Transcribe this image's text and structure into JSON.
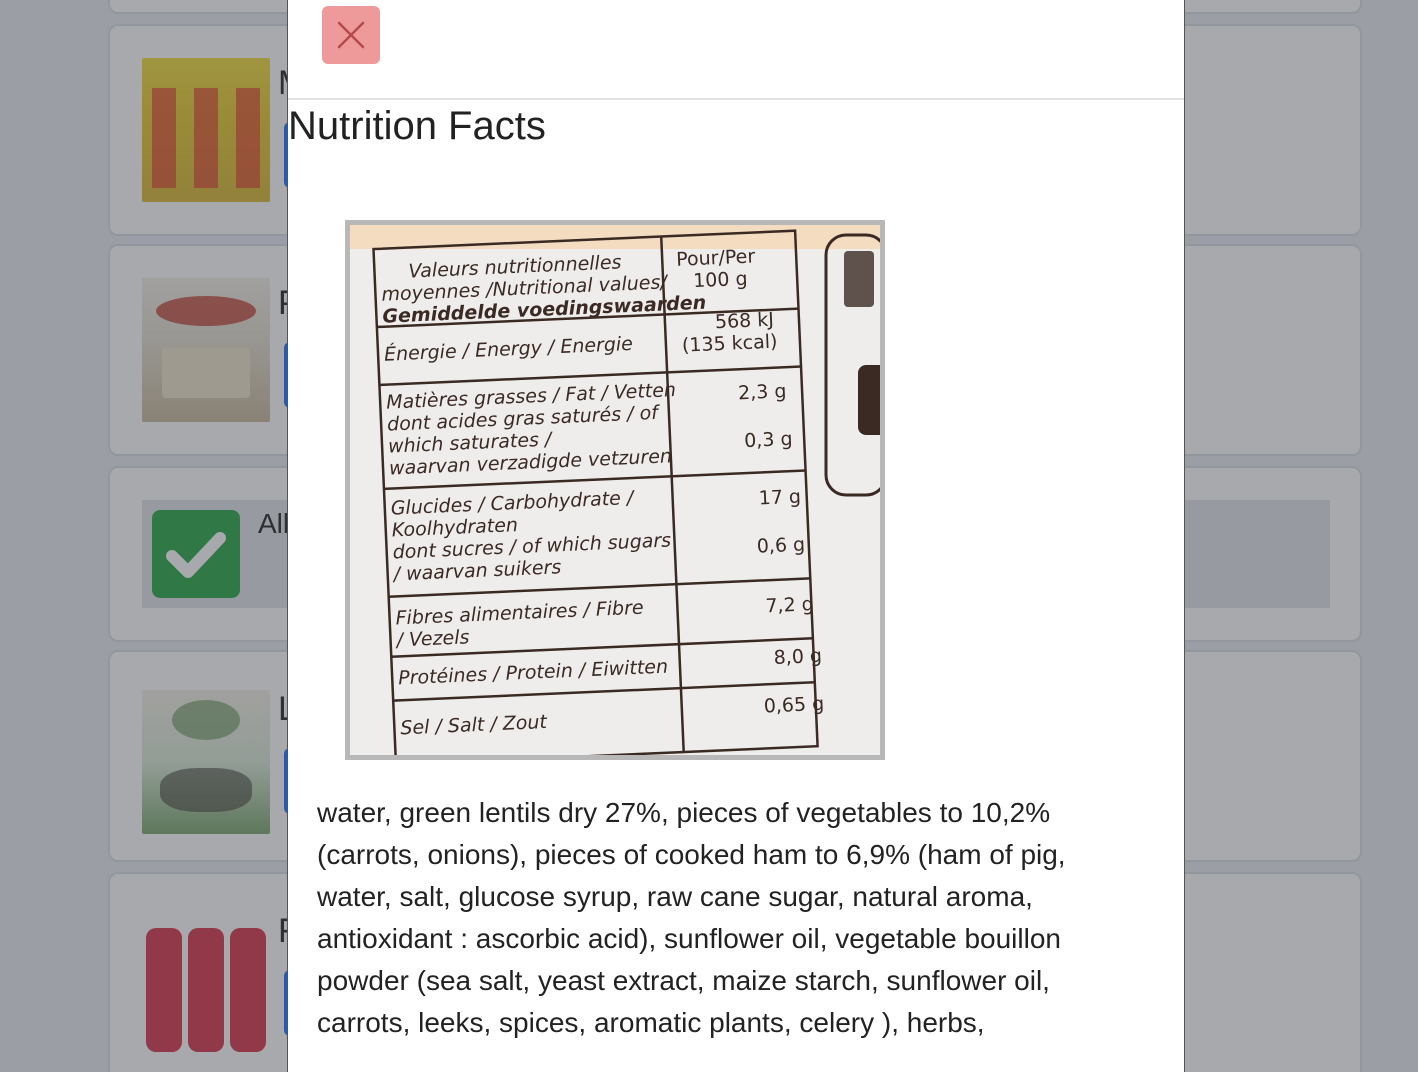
{
  "background": {
    "products": [
      {
        "letter": "M"
      },
      {
        "letter": "P"
      },
      {
        "status_text": "All"
      },
      {
        "letter": "L"
      },
      {
        "letter": "F"
      }
    ]
  },
  "modal": {
    "close_icon": "close-icon",
    "title": "Nutrition Facts",
    "nutrition_label": {
      "header_left": [
        "Valeurs nutritionnelles",
        "moyennes /Nutritional values/",
        "Gemiddelde voedingswaarden"
      ],
      "header_right": [
        "Pour/Per",
        "100 g"
      ],
      "rows": [
        {
          "label": [
            "Énergie / Energy / Energie"
          ],
          "values": [
            "568 kJ",
            "(135 kcal)"
          ]
        },
        {
          "label": [
            "Matières grasses / Fat / Vetten",
            "dont acides gras saturés / of",
            "which saturates /",
            "waarvan verzadigde vetzuren"
          ],
          "values": [
            "2,3 g",
            "0,3 g"
          ]
        },
        {
          "label": [
            "Glucides / Carbohydrate /",
            "Koolhydraten",
            "dont sucres / of which sugars",
            "/ waarvan suikers"
          ],
          "values": [
            "17 g",
            "0,6 g"
          ]
        },
        {
          "label": [
            "Fibres alimentaires / Fibre",
            "/ Vezels"
          ],
          "values": [
            "7,2 g"
          ]
        },
        {
          "label": [
            "Protéines / Protein / Eiwitten"
          ],
          "values": [
            "8,0 g"
          ]
        },
        {
          "label": [
            "Sel / Salt / Zout"
          ],
          "values": [
            "0,65 g"
          ]
        }
      ]
    },
    "ingredients": "water, green lentils dry 27%, pieces of vegetables to 10,2% (carrots, onions), pieces of cooked ham to 6,9% (ham of pig, water, salt, glucose syrup, raw cane sugar, natural aroma, antioxidant : ascorbic acid), sunflower oil, vegetable bouillon powder (sea salt, yeast extract, maize starch, sunflower oil, carrots, leeks, spices, aromatic plants, celery ), herbs,"
  }
}
